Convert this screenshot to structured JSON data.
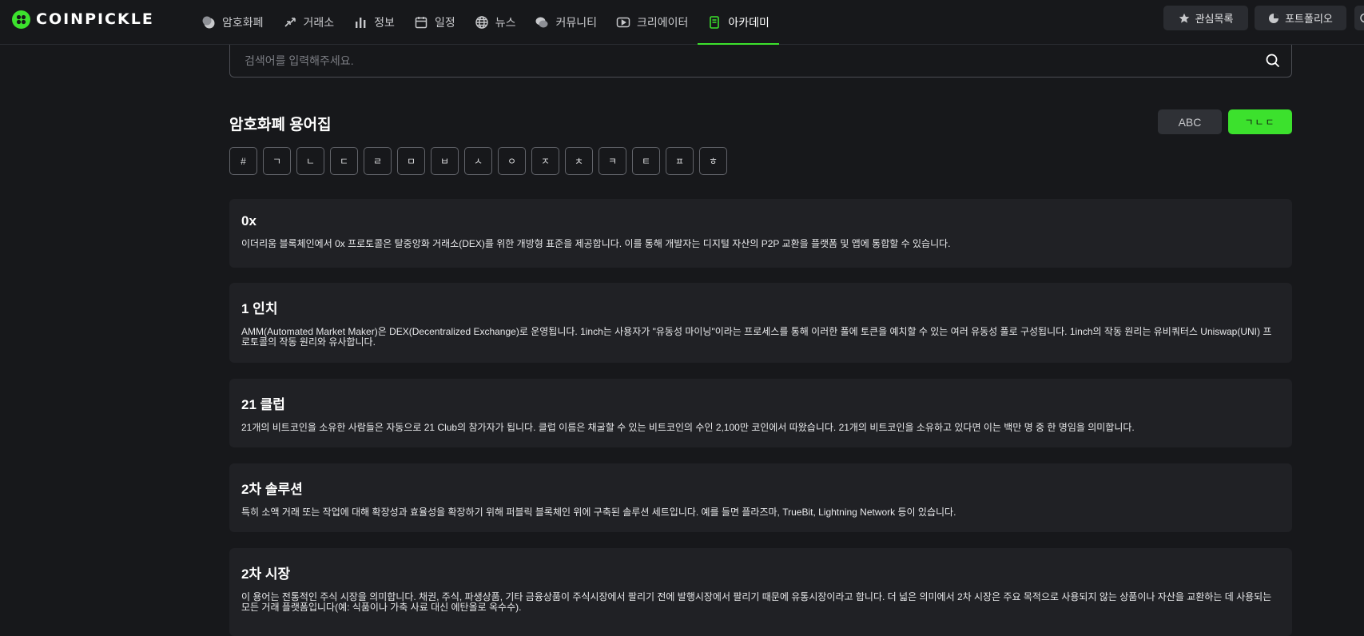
{
  "header": {
    "logo_text": "COINPICKLE",
    "nav": [
      {
        "label": "암호화폐",
        "icon": "coins-icon"
      },
      {
        "label": "거래소",
        "icon": "exchange-icon"
      },
      {
        "label": "정보",
        "icon": "bar-chart-icon"
      },
      {
        "label": "일정",
        "icon": "calendar-icon"
      },
      {
        "label": "뉴스",
        "icon": "globe-icon"
      },
      {
        "label": "커뮤니티",
        "icon": "chat-bubbles-icon"
      },
      {
        "label": "크리에이터",
        "icon": "play-icon"
      },
      {
        "label": "아카데미",
        "icon": "book-icon",
        "active": true
      }
    ],
    "watchlist_label": "관심목록",
    "portfolio_label": "포트폴리오"
  },
  "search": {
    "placeholder": "검색어를 입력해주세요.",
    "value": ""
  },
  "glossary": {
    "title": "암호화폐 용어집",
    "toggle_abc": "ABC",
    "toggle_korean": "ㄱㄴㄷ",
    "index": [
      "#",
      "ㄱ",
      "ㄴ",
      "ㄷ",
      "ㄹ",
      "ㅁ",
      "ㅂ",
      "ㅅ",
      "ㅇ",
      "ㅈ",
      "ㅊ",
      "ㅋ",
      "ㅌ",
      "ㅍ",
      "ㅎ"
    ],
    "entries": [
      {
        "term": "0x",
        "desc": "이더리움 블록체인에서 0x 프로토콜은 탈중앙화 거래소(DEX)를 위한 개방형 표준을 제공합니다. 이를 통해 개발자는 디지털 자산의 P2P 교환을 플랫폼 및 앱에 통합할 수 있습니다."
      },
      {
        "term": "1 인치",
        "desc": "AMM(Automated Market Maker)은 DEX(Decentralized Exchange)로 운영됩니다. 1inch는 사용자가 \"유동성 마이닝\"이라는 프로세스를 통해 이러한 풀에 토큰을 예치할 수 있는 여러 유동성 풀로 구성됩니다. 1inch의 작동 원리는 유비쿼터스 Uniswap(UNI) 프로토콜의 작동 원리와 유사합니다."
      },
      {
        "term": "21 클럽",
        "desc": "21개의 비트코인을 소유한 사람들은 자동으로 21 Club의 참가자가 됩니다. 클럽 이름은 채굴할 수 있는 비트코인의 수인 2,100만 코인에서 따왔습니다. 21개의 비트코인을 소유하고 있다면 이는 백만 명 중 한 명임을 의미합니다."
      },
      {
        "term": "2차 솔루션",
        "desc": "특히 소액 거래 또는 작업에 대해 확장성과 효율성을 확장하기 위해 퍼블릭 블록체인 위에 구축된 솔루션 세트입니다. 예를 들면 플라즈마, TrueBit, Lightning Network 등이 있습니다."
      },
      {
        "term": "2차 시장",
        "desc": "이 용어는 전통적인 주식 시장을 의미합니다. 채권, 주식, 파생상품, 기타 금융상품이 주식시장에서 팔리기 전에 발행시장에서 팔리기 때문에 유통시장이라고 합니다. 더 넓은 의미에서 2차 시장은 주요 목적으로 사용되지 않는 상품이나 자산을 교환하는 데 사용되는 모든 거래 플랫폼입니다(예: 식품이나 가축 사료 대신 에탄올로 옥수수)."
      }
    ]
  },
  "colors": {
    "accent": "#3ce12d",
    "background": "#17181b",
    "card": "#202125"
  }
}
